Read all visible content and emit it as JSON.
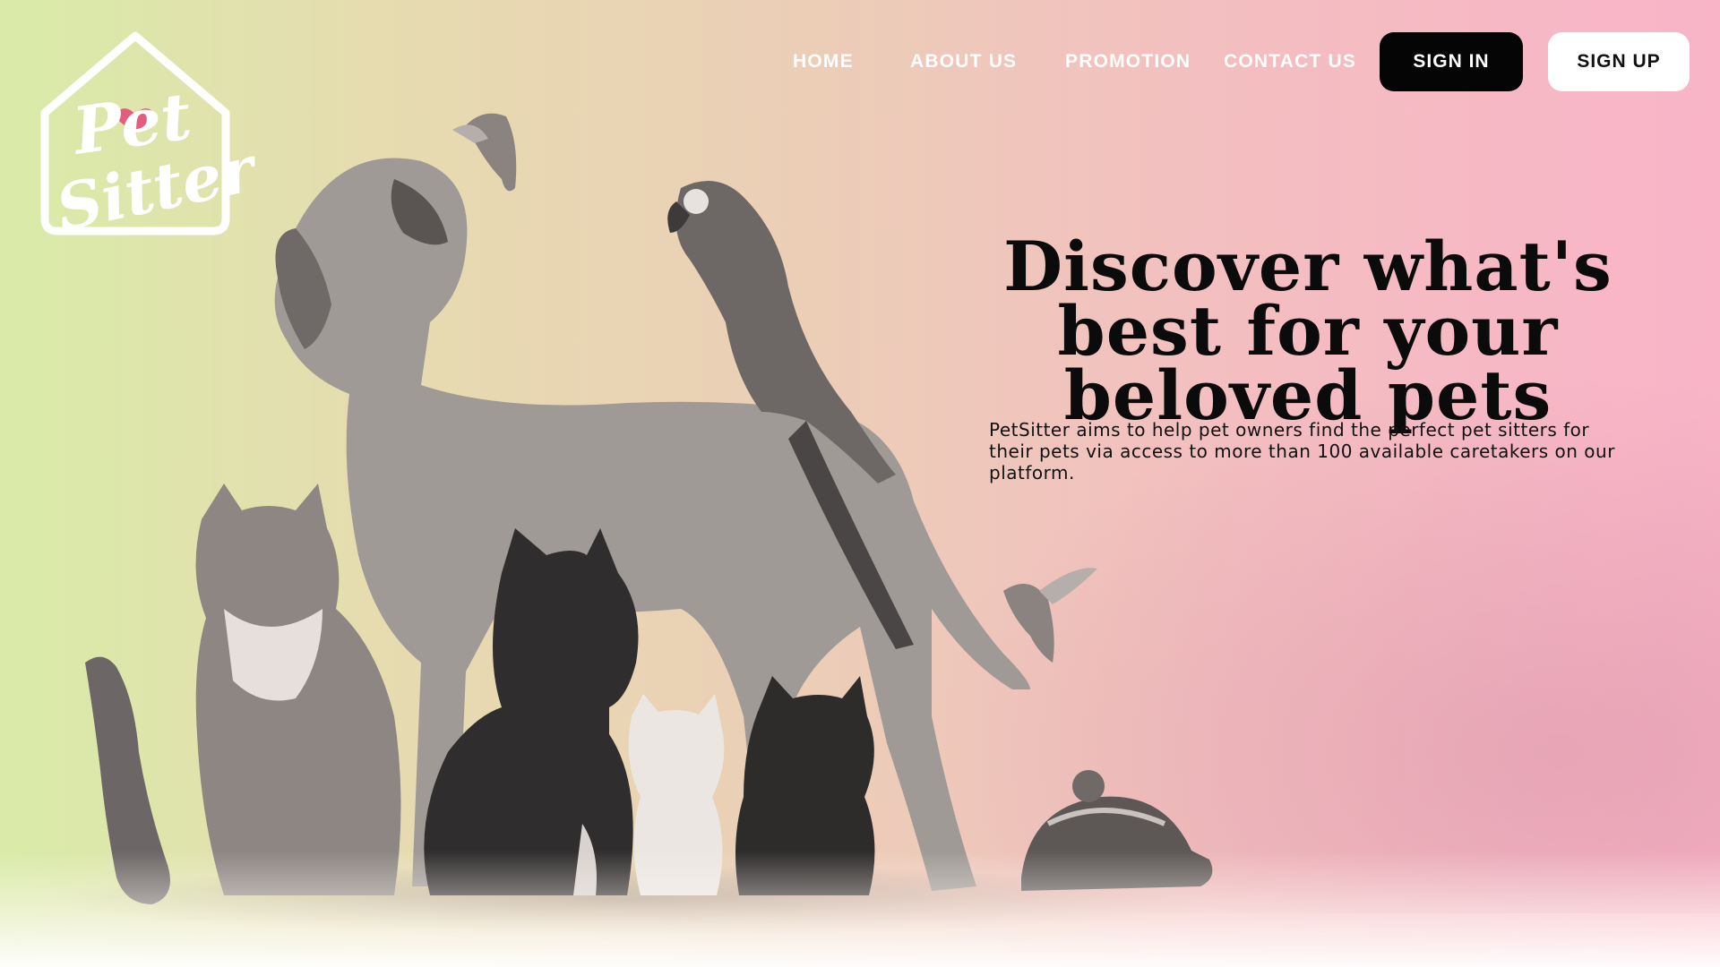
{
  "brand": {
    "logo_line1": "Pet",
    "logo_line2": "Sitter",
    "heart_color": "#e45d7e"
  },
  "nav": {
    "home": "HOME",
    "about": "ABOUT US",
    "promotion": "PROMOTION",
    "contact": "CONTACT US",
    "sign_in": "SIGN IN",
    "sign_up": "SIGN UP"
  },
  "hero": {
    "title": "Discover what's best for your beloved pets",
    "description": "PetSitter aims to help pet owners find the perfect pet sitters for their pets via access to more than 100 available caretakers on our platform."
  },
  "illustration": {
    "subjects": [
      "great-dane",
      "parrot",
      "cat",
      "french-bulldog",
      "white-kitten",
      "black-kitten",
      "ferret",
      "tortoise",
      "bird",
      "bird"
    ]
  },
  "colors": {
    "bg_left": "#d9eba8",
    "bg_right": "#f9b4c8",
    "primary_button": "#050505",
    "secondary_button": "#ffffff"
  }
}
